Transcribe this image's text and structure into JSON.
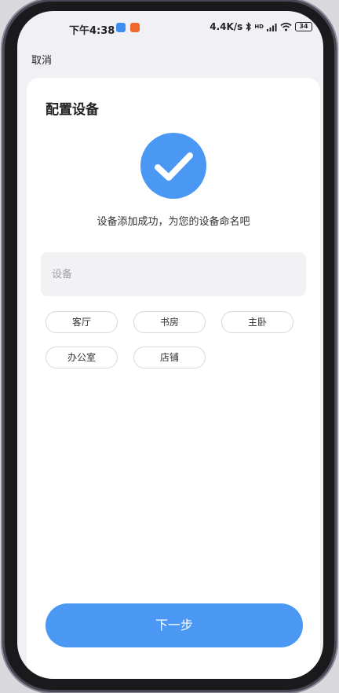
{
  "status_bar": {
    "time": "下午4:38",
    "network_speed": "4.4K/s",
    "network_type": "HD",
    "battery_level": "34",
    "icons": [
      "app-badge-blue",
      "app-badge-orange",
      "bluetooth-icon",
      "cellular-signal-icon",
      "wifi-icon",
      "battery-icon"
    ]
  },
  "nav": {
    "cancel_label": "取消"
  },
  "card": {
    "title": "配置设备",
    "success_icon": "check-circle-icon",
    "success_message": "设备添加成功，为您的设备命名吧"
  },
  "name_field": {
    "placeholder": "设备",
    "value": ""
  },
  "room_chips": [
    "客厅",
    "书房",
    "主卧",
    "办公室",
    "店铺"
  ],
  "next_button": {
    "label": "下一步"
  },
  "colors": {
    "accent": "#4a97f4",
    "input_background": "#f2f2f4",
    "page_background": "#f1f1f5",
    "card_background": "#ffffff"
  }
}
